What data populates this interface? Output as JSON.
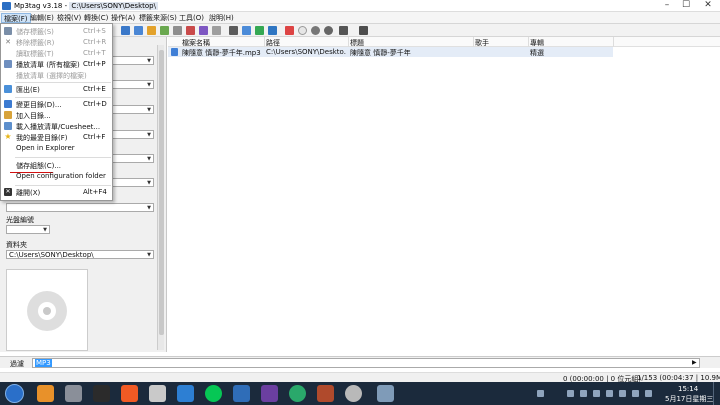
{
  "window": {
    "app_title": "Mp3tag v3.18  -  ",
    "path_title": "C:\\Users\\SONY\\Desktop\\",
    "min": "–",
    "max": "☐",
    "close": "✕"
  },
  "menubar": [
    "檔案(F)",
    "編輯(E)",
    "檢視(V)",
    "轉換(C)",
    "操作(A)",
    "標籤來源(S)",
    "工具(O)",
    "說明(H)"
  ],
  "file_menu": {
    "items": [
      {
        "label": "儲存標籤(S)",
        "shortcut": "Ctrl+S",
        "icon": "save-icon",
        "disabled": true
      },
      {
        "label": "移除標籤(R)",
        "shortcut": "Ctrl+R",
        "icon": "remove-icon",
        "disabled": true
      },
      {
        "label": "讀取標籤(T)",
        "shortcut": "Ctrl+T",
        "icon": "",
        "disabled": true
      },
      {
        "label": "播放清單 (所有檔案)",
        "shortcut": "Ctrl+P",
        "icon": "playlist-icon",
        "disabled": false
      },
      {
        "label": "播放清單 (選擇的檔案)",
        "shortcut": "",
        "icon": "",
        "disabled": true
      },
      {
        "label": "匯出(E)",
        "shortcut": "Ctrl+E",
        "icon": "export-icon",
        "disabled": false
      },
      {
        "label": "變更目錄(D)...",
        "shortcut": "Ctrl+D",
        "icon": "change-directory-icon",
        "disabled": false
      },
      {
        "label": "加入目錄...",
        "shortcut": "",
        "icon": "add-directory-icon",
        "disabled": false
      },
      {
        "label": "載入播放清單/Cuesheet...",
        "shortcut": "",
        "icon": "load-playlist-icon",
        "disabled": false
      },
      {
        "label": "我的最愛目錄(F)",
        "shortcut": "Ctrl+F",
        "icon": "favorites-star-icon",
        "disabled": false
      },
      {
        "label": "Open in Explorer",
        "shortcut": "",
        "icon": "",
        "disabled": false
      },
      {
        "label": "儲存組態(C)...",
        "shortcut": "",
        "icon": "",
        "disabled": false
      },
      {
        "label": "Open configuration folder",
        "shortcut": "",
        "icon": "",
        "disabled": false
      },
      {
        "label": "離開(X)",
        "shortcut": "Alt+F4",
        "icon": "exit-icon",
        "disabled": false
      }
    ]
  },
  "left_panel": {
    "disc_label": "光盤編號",
    "folder_label": "資料夾",
    "folder_value": "C:\\Users\\SONY\\Desktop\\"
  },
  "file_list": {
    "columns": [
      "檔案名稱",
      "路徑",
      "標題",
      "歌手",
      "專輯"
    ],
    "rows": [
      {
        "filename": "陳隨意 慎靜-夢千年.mp3",
        "path": "C:\\Users\\SONY\\Deskto...",
        "title": "陳隨意 慎靜-夢千年",
        "artist": "",
        "album": "精選"
      }
    ]
  },
  "filter": {
    "label": "過濾",
    "value": "MP3",
    "arrow": "▶"
  },
  "status": {
    "selection": "0 (00:00:00 | 0 位元組)",
    "total": "1/153 (00:04:37 | 10.9MB)"
  },
  "taskbar": {
    "time": "15:14",
    "date": "5月17日星期三"
  },
  "colors": {
    "taskbar": "#1b2a3c",
    "selection_row": "#e4ecf7",
    "highlight": "#3399ff",
    "red_mark": "#d01010"
  }
}
